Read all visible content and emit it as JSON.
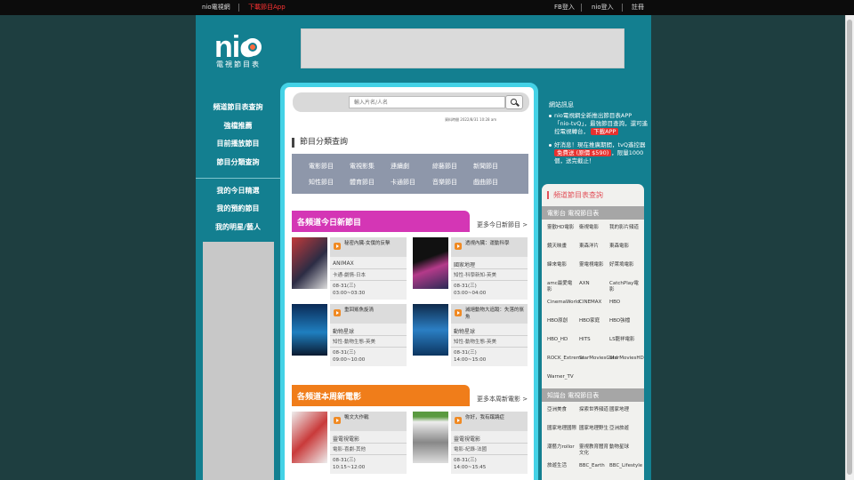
{
  "topbar": {
    "site": "nio電視網",
    "app_link": "下載節目App",
    "fb_login": "FB登入",
    "nio_login": "nio登入",
    "register": "註冊"
  },
  "logo": {
    "word": "nio",
    "sub": "電視節目表"
  },
  "leftnav": {
    "items": [
      "頻道節目表查詢",
      "強檔推薦",
      "目前播放節目",
      "節目分類查詢"
    ],
    "my_items": [
      "我的今日精選",
      "我的預約節目",
      "我的明星/藝人"
    ]
  },
  "search": {
    "placeholder": "輸入片名/人名"
  },
  "updated": "資料時間 2022/8/31 10:28 am",
  "category": {
    "title": "節目分類查詢",
    "row1": [
      "電影節目",
      "電視影集",
      "連續劇",
      "綜藝節目",
      "新聞節目"
    ],
    "row2": [
      "知性節目",
      "體育節目",
      "卡通節目",
      "音樂節目",
      "戲曲節目"
    ]
  },
  "today_new": {
    "title": "各頻道今日新節目",
    "more": "更多今日新節目 >",
    "cards": [
      {
        "title": "秘密內臟-女僕的反擊",
        "channel": "ANIMAX",
        "genre": "卡通-劇情-日本",
        "date": "08-31(三)",
        "time": "03:00~03:30"
      },
      {
        "title": "透視內臟：運動科學",
        "channel": "國家地理",
        "genre": "知性-科學新知-英美",
        "date": "08-31(三)",
        "time": "03:00~04:00"
      },
      {
        "title": "重回鯊魚旋渦",
        "channel": "動物星球",
        "genre": "知性-動物生態-英美",
        "date": "08-31(三)",
        "time": "09:00~10:00"
      },
      {
        "title": "滅絕動物大追蹤：失落的鯊魚",
        "channel": "動物星球",
        "genre": "知性-動物生態-英美",
        "date": "08-31(三)",
        "time": "14:00~15:00"
      }
    ]
  },
  "week_movies": {
    "title": "各頻道本周新電影",
    "more": "更多本周新電影 >",
    "cards": [
      {
        "title": "鴨文大作戰",
        "channel": "靈電視電影",
        "genre": "電影-喜劇-其他",
        "date": "08-31(三)",
        "time": "10:15~12:00"
      },
      {
        "title": "你好，我有蹊蹺症",
        "channel": "靈電視電影",
        "genre": "電影-紀錄-法國",
        "date": "08-31(三)",
        "time": "14:00~15:45"
      }
    ]
  },
  "news": {
    "title": "網站訊息",
    "item1_pre": "nio電視網全新推出節目表APP「nio-tvQ」，最強節目查詢，還可遙控電視轉台，",
    "item1_tag": "下載APP",
    "item2_pre": "好消息！現在推廣期間，tvQ遙控器",
    "item2_tag": "免費送 (原價 $590)",
    "item2_post": "，限量1000個，送完截止！"
  },
  "right_panel": {
    "title": "頻道節目表查詢",
    "movie_band": "電影台 電視節目表",
    "movie_channels": [
      "靈歡HD電影",
      "衛視電影",
      "我的影片頻道",
      "鏡天映畫",
      "東森洋片",
      "東森電影",
      "緯來電影",
      "靈電視電影",
      "好萊塢電影",
      "amc最愛電影",
      "AXN",
      "CatchPlay電影",
      "CinemaWorld",
      "CINEMAX",
      "HBO",
      "HBO原創",
      "HBO家庭",
      "HBO強檔",
      "HBO_HD",
      "HITS",
      "LS龍祥電影",
      "ROCK_Extreme",
      "StarMoviesGold",
      "StarMoviesHD",
      "Warner_TV"
    ],
    "know_band": "知識台 電視節目表",
    "know_channels": [
      "亞洲美食",
      "探索世界頻道",
      "國家地理",
      "國家地理國際",
      "國家地理野生",
      "亞洲旅遊",
      "潮藝力rollor",
      "靈視教育體育文化",
      "動物星球",
      "旅遊生活",
      "BBC_Earth",
      "BBC_Lifestyle"
    ]
  }
}
